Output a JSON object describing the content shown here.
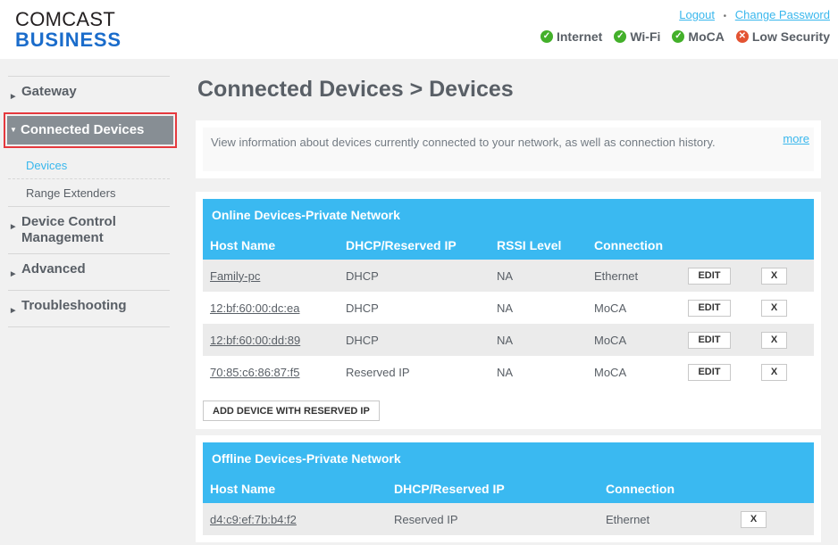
{
  "header": {
    "logo_line1": "COMCAST",
    "logo_line2": "BUSINESS",
    "logout_label": "Logout",
    "separator": "•",
    "change_password_label": "Change Password",
    "status": [
      {
        "label": "Internet",
        "state": "ok",
        "icon": "check-circle-icon"
      },
      {
        "label": "Wi-Fi",
        "state": "ok",
        "icon": "check-circle-icon"
      },
      {
        "label": "MoCA",
        "state": "ok",
        "icon": "check-circle-icon"
      },
      {
        "label": "Low Security",
        "state": "error",
        "icon": "x-circle-icon"
      }
    ]
  },
  "sidebar": {
    "items": [
      {
        "label": "Gateway",
        "expanded": false
      },
      {
        "label": "Connected Devices",
        "expanded": true,
        "active": true,
        "children": [
          {
            "label": "Devices",
            "current": true
          },
          {
            "label": "Range Extenders",
            "current": false
          }
        ]
      },
      {
        "label": "Device Control Management",
        "line1": "Device Control",
        "line2": "Management",
        "expanded": false
      },
      {
        "label": "Advanced",
        "expanded": false
      },
      {
        "label": "Troubleshooting",
        "expanded": false
      }
    ]
  },
  "main": {
    "title": "Connected Devices > Devices",
    "intro": {
      "text": "View information about devices currently connected to your network, as well as connection history.",
      "more_label": "more"
    },
    "online": {
      "title": "Online Devices-Private Network",
      "columns": [
        "Host Name",
        "DHCP/Reserved IP",
        "RSSI Level",
        "Connection"
      ],
      "rows": [
        {
          "host": "Family-pc",
          "ip_type": "DHCP",
          "rssi": "NA",
          "connection": "Ethernet"
        },
        {
          "host": "12:bf:60:00:dc:ea",
          "ip_type": "DHCP",
          "rssi": "NA",
          "connection": "MoCA"
        },
        {
          "host": "12:bf:60:00:dd:89",
          "ip_type": "DHCP",
          "rssi": "NA",
          "connection": "MoCA"
        },
        {
          "host": "70:85:c6:86:87:f5",
          "ip_type": "Reserved IP",
          "rssi": "NA",
          "connection": "MoCA"
        }
      ],
      "edit_label": "EDIT",
      "delete_label": "X",
      "add_label": "ADD DEVICE WITH RESERVED IP"
    },
    "offline": {
      "title": "Offline Devices-Private Network",
      "columns": [
        "Host Name",
        "DHCP/Reserved IP",
        "Connection"
      ],
      "rows": [
        {
          "host": "d4:c9:ef:7b:b4:f2",
          "ip_type": "Reserved IP",
          "connection": "Ethernet"
        }
      ],
      "delete_label": "X"
    }
  },
  "colors": {
    "accent": "#3ab9f1",
    "brand_blue": "#1a6ccb",
    "ok": "#43b02a",
    "error": "#e35332",
    "highlight_border": "#e5393e"
  }
}
